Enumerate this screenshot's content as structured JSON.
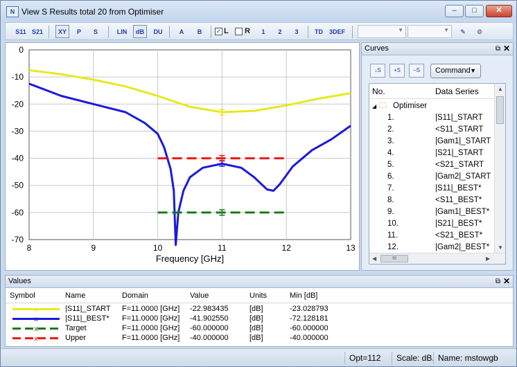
{
  "window": {
    "title": "View S Results total 20 from Optimiser",
    "app_icon": "nwa-logo-icon"
  },
  "toolbar": {
    "buttons": [
      "S11",
      "S21",
      "XY",
      "P",
      "S",
      "LIN",
      "dB",
      "DU",
      "A",
      "B"
    ],
    "checkbox_l": "L",
    "checkbox_r": "R",
    "marker_buttons": [
      "1",
      "2",
      "3"
    ],
    "tail_buttons": [
      "TD",
      "3DEF"
    ],
    "combo1": "",
    "combo2": ""
  },
  "curves_panel": {
    "title": "Curves",
    "command_label": "Command",
    "tree": {
      "col_no": "No.",
      "col_series": "Data Series",
      "group": "Optimiser",
      "rows": [
        {
          "no": "1.",
          "name": "|S11|_START"
        },
        {
          "no": "2.",
          "name": "<S11_START"
        },
        {
          "no": "3.",
          "name": "|Gam1|_START"
        },
        {
          "no": "4.",
          "name": "|S21|_START"
        },
        {
          "no": "5.",
          "name": "<S21_START"
        },
        {
          "no": "6.",
          "name": "|Gam2|_START"
        },
        {
          "no": "7.",
          "name": "|S11|_BEST*"
        },
        {
          "no": "8.",
          "name": "<S11_BEST*"
        },
        {
          "no": "9.",
          "name": "|Gam1|_BEST*"
        },
        {
          "no": "10.",
          "name": "|S21|_BEST*"
        },
        {
          "no": "11.",
          "name": "<S21_BEST*"
        },
        {
          "no": "12.",
          "name": "|Gam2|_BEST*"
        }
      ],
      "hscroll_label": "III"
    }
  },
  "values_panel": {
    "title": "Values",
    "headers": {
      "symbol": "Symbol",
      "name": "Name",
      "domain": "Domain",
      "value": "Value",
      "units": "Units",
      "min": "Min [dB]"
    },
    "rows": [
      {
        "name": "|S11|_START",
        "domain": "F=11.0000 [GHz]",
        "value": "-22.983435",
        "units": "[dB]",
        "min": "-23.028793",
        "color": "#e8e820",
        "style": "solid"
      },
      {
        "name": "|S11|_BEST*",
        "domain": "F=11.0000 [GHz]",
        "value": "-41.902550",
        "units": "[dB]",
        "min": "-72.128181",
        "color": "#1a1adb",
        "style": "solid"
      },
      {
        "name": "Target",
        "domain": "F=11.0000 [GHz]",
        "value": "-60.000000",
        "units": "[dB]",
        "min": "-60.000000",
        "color": "#1a7a1a",
        "style": "dashed"
      },
      {
        "name": "Upper",
        "domain": "F=11.0000 [GHz]",
        "value": "-40.000000",
        "units": "[dB]",
        "min": "-40.000000",
        "color": "#e81a1a",
        "style": "dashed"
      }
    ]
  },
  "status": {
    "opt": "Opt=112",
    "scale": "Scale: dB.",
    "name": "Name: mstowgb"
  },
  "chart_data": {
    "type": "line",
    "xlabel": "Frequency [GHz]",
    "ylabel": "",
    "xlim": [
      8,
      13
    ],
    "ylim": [
      -70,
      0
    ],
    "xticks": [
      "8",
      "9",
      "10",
      "11",
      "12",
      "13"
    ],
    "yticks": [
      "0",
      "-10",
      "-20",
      "-30",
      "-40",
      "-50",
      "-60",
      "-70"
    ],
    "grid": true,
    "series": [
      {
        "name": "|S11|_START",
        "color": "#e8e820",
        "dashed": false,
        "x": [
          8,
          8.5,
          9,
          9.5,
          10,
          10.5,
          11,
          11.5,
          12,
          12.5,
          13
        ],
        "y": [
          -7.5,
          -9,
          -11,
          -13.5,
          -17,
          -21,
          -23,
          -22.5,
          -20.5,
          -18,
          -16
        ]
      },
      {
        "name": "|S11|_BEST*",
        "color": "#1a1adb",
        "dashed": false,
        "x": [
          8,
          8.5,
          9,
          9.5,
          9.8,
          10,
          10.1,
          10.2,
          10.25,
          10.28,
          10.32,
          10.4,
          10.5,
          10.7,
          11,
          11.3,
          11.5,
          11.7,
          11.8,
          11.9,
          12.1,
          12.4,
          12.7,
          13
        ],
        "y": [
          -12.5,
          -17,
          -20,
          -23,
          -27,
          -31,
          -36,
          -44,
          -52,
          -72,
          -60,
          -52,
          -47,
          -43.5,
          -42,
          -43.5,
          -47,
          -51.5,
          -52,
          -49.5,
          -43,
          -37,
          -33,
          -28
        ]
      },
      {
        "name": "Target",
        "color": "#1a7a1a",
        "dashed": true,
        "x": [
          10,
          12
        ],
        "y": [
          -60,
          -60
        ]
      },
      {
        "name": "Upper",
        "color": "#e81a1a",
        "dashed": true,
        "x": [
          10,
          12
        ],
        "y": [
          -40,
          -40
        ]
      }
    ],
    "markers": [
      {
        "series": "|S11|_START",
        "x": 11,
        "y": -22.983435
      },
      {
        "series": "|S11|_BEST*",
        "x": 11,
        "y": -41.90255
      },
      {
        "series": "Target",
        "x": 11,
        "y": -60
      },
      {
        "series": "Upper",
        "x": 11,
        "y": -40
      }
    ]
  }
}
